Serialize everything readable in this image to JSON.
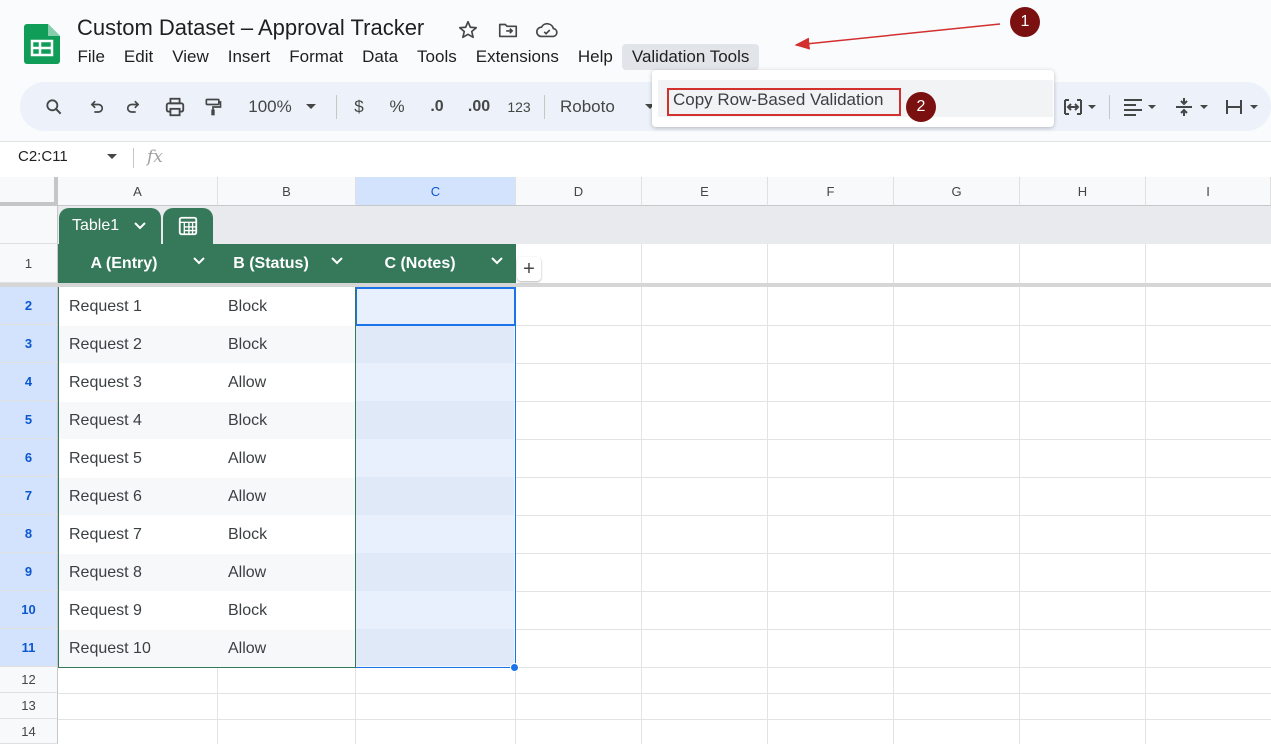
{
  "app": {
    "doc_title": "Custom Dataset – Approval Tracker",
    "menus": [
      "File",
      "Edit",
      "View",
      "Insert",
      "Format",
      "Data",
      "Tools",
      "Extensions",
      "Help",
      "Validation Tools"
    ],
    "active_menu_index": 9
  },
  "dropdown": {
    "item_label": "Copy Row-Based Validation"
  },
  "toolbar": {
    "zoom": "100%",
    "currency": "$",
    "percent": "%",
    "decrease_decimal": ".0",
    "increase_decimal": ".00",
    "number_format": "123",
    "font": "Roboto"
  },
  "formula_bar": {
    "name_box": "C2:C11",
    "fx": "fx"
  },
  "grid": {
    "columns": [
      "A",
      "B",
      "C",
      "D",
      "E",
      "F",
      "G",
      "H",
      "I"
    ],
    "selected_column": "C",
    "row_numbers": [
      "1",
      "2",
      "3",
      "4",
      "5",
      "6",
      "7",
      "8",
      "9",
      "10",
      "11",
      "12",
      "13",
      "14"
    ]
  },
  "table": {
    "name": "Table1",
    "headers": [
      "A (Entry)",
      "B (Status)",
      "C (Notes)"
    ],
    "rows": [
      {
        "entry": "Request 1",
        "status": "Block",
        "notes": ""
      },
      {
        "entry": "Request 2",
        "status": "Block",
        "notes": ""
      },
      {
        "entry": "Request 3",
        "status": "Allow",
        "notes": ""
      },
      {
        "entry": "Request 4",
        "status": "Block",
        "notes": ""
      },
      {
        "entry": "Request 5",
        "status": "Allow",
        "notes": ""
      },
      {
        "entry": "Request 6",
        "status": "Allow",
        "notes": ""
      },
      {
        "entry": "Request 7",
        "status": "Block",
        "notes": ""
      },
      {
        "entry": "Request 8",
        "status": "Allow",
        "notes": ""
      },
      {
        "entry": "Request 9",
        "status": "Block",
        "notes": ""
      },
      {
        "entry": "Request 10",
        "status": "Allow",
        "notes": ""
      }
    ]
  },
  "annotations": {
    "step1": "1",
    "step2": "2"
  },
  "colors": {
    "table_green": "#35785a",
    "selection_blue": "#1a73e8",
    "annotation_red": "#d32f2f",
    "badge": "#7b1010"
  },
  "icons": [
    "sheets-logo-icon",
    "star-icon",
    "move-folder-icon",
    "cloud-saved-icon",
    "search-icon",
    "undo-icon",
    "redo-icon",
    "print-icon",
    "paint-format-icon",
    "chevron-down-icon",
    "merge-cells-icon",
    "align-left-icon",
    "vertical-align-icon",
    "text-wrap-icon",
    "table-settings-icon",
    "add-column-icon"
  ]
}
